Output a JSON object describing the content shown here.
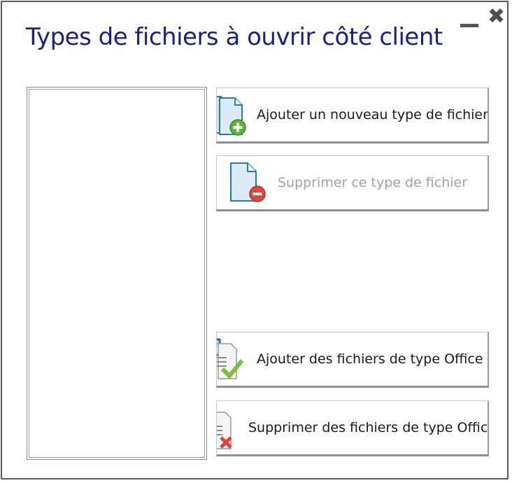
{
  "window": {
    "title": "Types de fichiers à ouvrir côté client",
    "minimize_icon": "minimize-icon",
    "close_icon": "close-icon"
  },
  "file_types_list": {
    "items": []
  },
  "buttons": {
    "add_type": {
      "label": "Ajouter un nouveau type de fichier",
      "icon": "file-add-icon",
      "enabled": true
    },
    "delete_type": {
      "label": "Supprimer ce type de fichier",
      "icon": "file-remove-icon",
      "enabled": false
    },
    "add_office": {
      "label": "Ajouter des fichiers de type Office",
      "icon": "office-files-add-icon",
      "enabled": true
    },
    "delete_office": {
      "label": "Supprimer des fichiers de type Office",
      "icon": "office-files-remove-icon",
      "enabled": true
    }
  },
  "colors": {
    "title": "#1b1f8c",
    "disabled_text": "#a3a3a3",
    "add_badge": "#5ab52e",
    "remove_badge": "#e0463c",
    "check_mark": "#7cc13a",
    "cross_mark": "#e0463c",
    "word_blue": "#2a5ea8"
  }
}
